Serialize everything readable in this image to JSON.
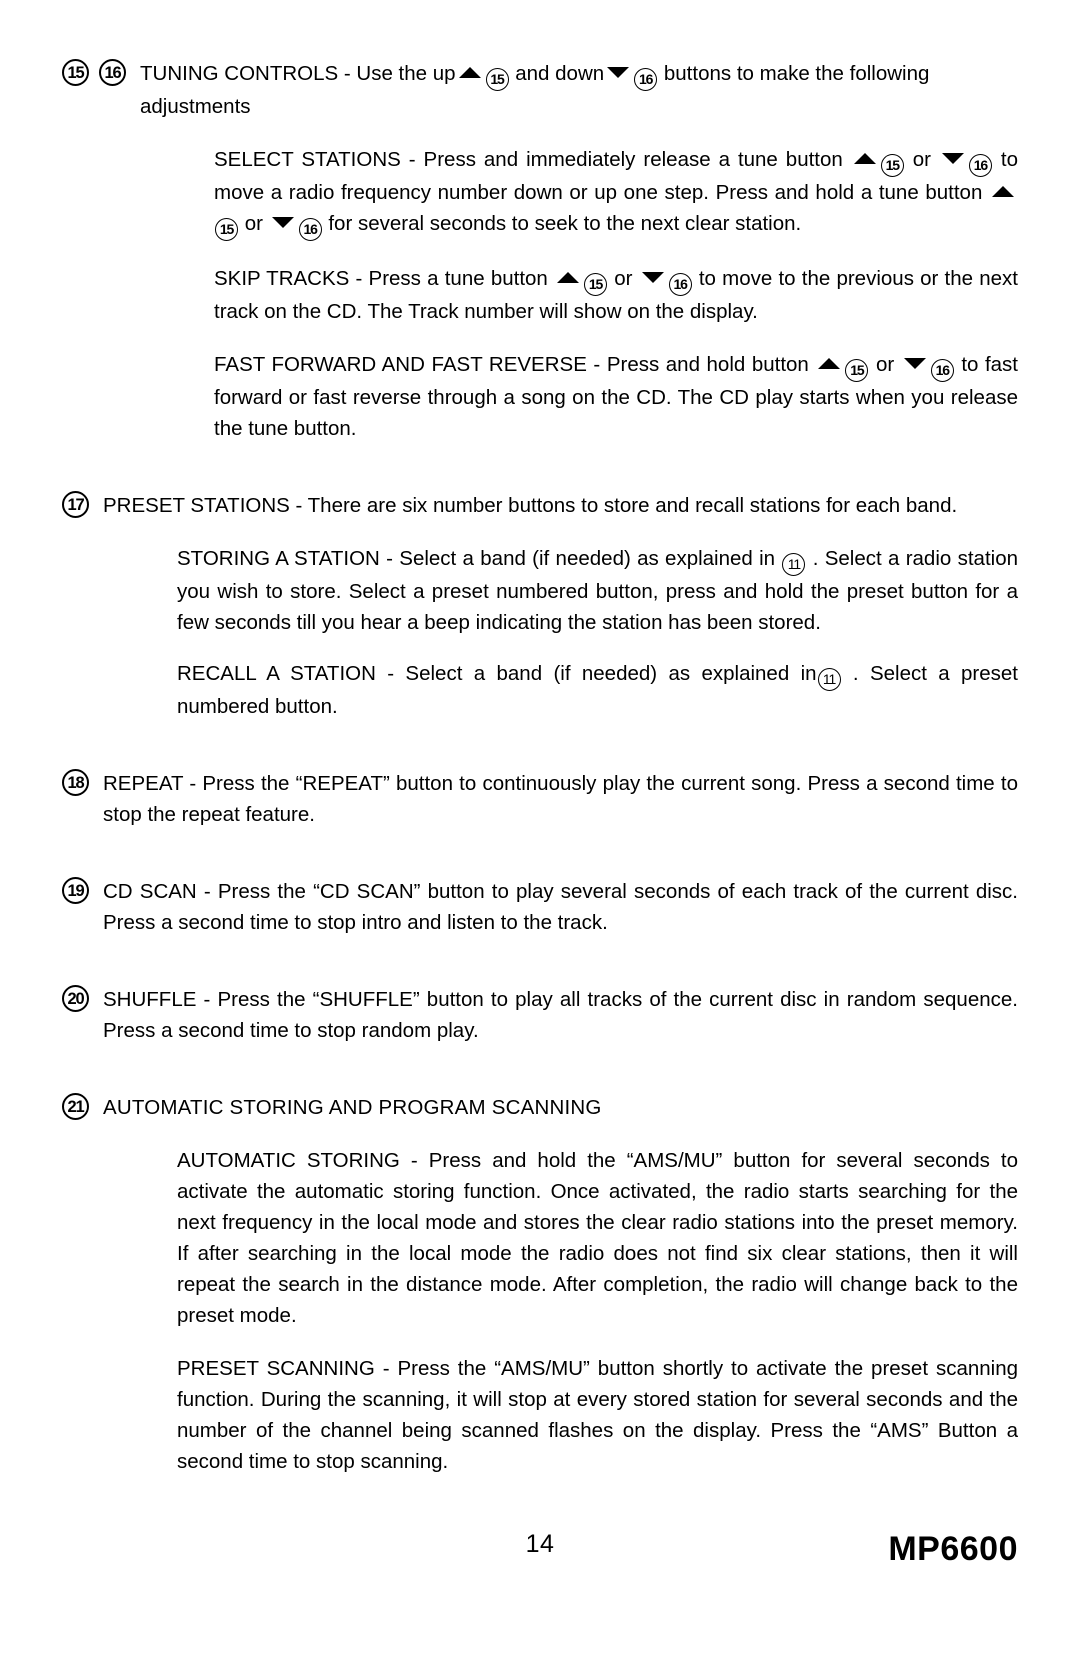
{
  "page": {
    "number": "14",
    "model": "MP6600"
  },
  "items": [
    {
      "id": "tuning-controls",
      "markers": [
        "15",
        "16"
      ],
      "lead_part1": "TUNING CONTROLS - Use the up",
      "lead_ref1": "15",
      "lead_part2": "and down",
      "lead_ref2": "16",
      "lead_part3": "buttons to make the following adjustments",
      "subs": [
        {
          "id": "select-stations",
          "p1": "SELECT STATIONS - Press and immediately release a tune button",
          "r1": "15",
          "p2": "or",
          "r2": "16",
          "p3": "to move a radio frequency number down or up one step. Press and hold a tune button",
          "r3": "15",
          "p4": "or",
          "r4": "16",
          "p5": "for several seconds to seek to the next clear station."
        },
        {
          "id": "skip-tracks",
          "p1": "SKIP TRACKS - Press a tune button",
          "r1": "15",
          "p2": "or",
          "r2": "16",
          "p3": "to move to the previous or the next track on the CD.  The Track number will show on the display."
        },
        {
          "id": "fast-forward-fast-reverse",
          "p1": "FAST FORWARD AND FAST REVERSE - Press and hold button",
          "r1": "15",
          "p2": "or",
          "r2": "16",
          "p3": "to fast forward or fast reverse through a song on the CD.  The CD play starts when you release the tune button."
        }
      ]
    },
    {
      "id": "preset-stations",
      "markers": [
        "17"
      ],
      "lead": "PRESET STATIONS - There are six number buttons to store and recall stations for each band.",
      "subs": [
        {
          "id": "storing-a-station",
          "p1": "STORING A STATION -  Select a band (if needed) as explained in",
          "r1": "11",
          "p2": ".  Select a radio station you wish to store. Select a preset numbered button, press and hold the preset button for a few seconds till you hear a beep indicating the station has been stored."
        },
        {
          "id": "recall-a-station",
          "p1": "RECALL A STATION -  Select a band (if needed) as explained in",
          "r1": "11",
          "p2": ". Select a preset numbered button."
        }
      ]
    },
    {
      "id": "repeat",
      "markers": [
        "18"
      ],
      "lead": "REPEAT - Press the “REPEAT” button to continuously play the current song.  Press a second time to stop the repeat feature."
    },
    {
      "id": "cd-scan",
      "markers": [
        "19"
      ],
      "lead": "CD SCAN - Press the “CD SCAN” button to play several seconds of  each track of  the current disc. Press a second time to stop intro and listen to the track."
    },
    {
      "id": "shuffle",
      "markers": [
        "20"
      ],
      "lead": "SHUFFLE - Press the “SHUFFLE” button to play all tracks of the current disc in random sequence. Press a second time to stop random play."
    },
    {
      "id": "automatic-storing-and-program-scanning",
      "markers": [
        "21"
      ],
      "lead": "AUTOMATIC STORING AND PROGRAM SCANNING",
      "subs": [
        {
          "id": "automatic-storing",
          "p1": "AUTOMATIC STORING - Press and hold the “AMS/MU” button for several seconds to activate the automatic storing function.   Once activated, the radio starts searching for  the next  frequency in the local mode and stores the clear radio stations into the preset memory. If after searching  in the local mode the radio does not find six clear stations, then it will repeat the search in the distance mode. After completion, the radio will change back to the preset mode."
        },
        {
          "id": "preset-scanning",
          "p1": "PRESET SCANNING - Press  the “AMS/MU” button shortly to activate the preset scanning function. During the scanning, it will stop at every stored station for several seconds and the number of  the channel being scanned flashes on the display. Press the “AMS” Button a second time to stop scanning."
        }
      ]
    }
  ]
}
